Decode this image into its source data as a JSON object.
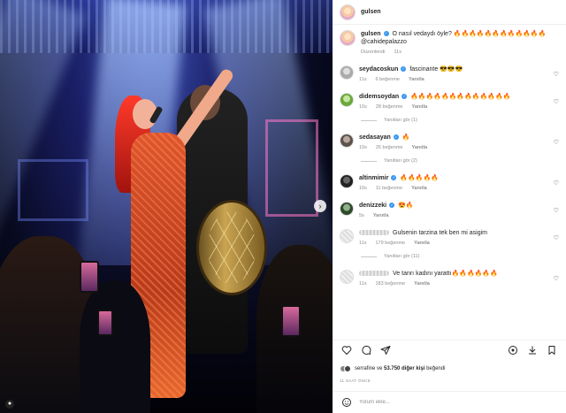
{
  "header": {
    "username": "gulsen"
  },
  "caption": {
    "username": "gulsen",
    "text": "O nasıl vedaydı öyle? 🔥🔥🔥🔥🔥🔥🔥🔥🔥🔥🔥🔥",
    "mention": "@cahidepalazzo",
    "edited": "Düzenlendi",
    "time": "11s"
  },
  "comments": [
    {
      "username": "seydacoskun",
      "text": "fascinante 😎😎😎",
      "time": "11s",
      "likes": "6 beğenme",
      "reply": "Yanıtla",
      "view_replies": ""
    },
    {
      "username": "didemsoydan",
      "text": "🔥🔥🔥🔥🔥🔥🔥🔥🔥🔥🔥🔥🔥",
      "time": "10s",
      "likes": "28 beğenme",
      "reply": "Yanıtla",
      "view_replies": "Yanıtları gör (1)"
    },
    {
      "username": "sedasayan",
      "text": "🔥",
      "time": "10s",
      "likes": "26 beğenme",
      "reply": "Yanıtla",
      "view_replies": "Yanıtları gör (2)"
    },
    {
      "username": "altinmimir",
      "text": "🔥🔥🔥🔥🔥",
      "time": "10s",
      "likes": "11 beğenme",
      "reply": "Yanıtla",
      "view_replies": ""
    },
    {
      "username": "denizzeki",
      "text": "😍🔥",
      "time": "5s",
      "likes": "",
      "reply": "Yanıtla",
      "view_replies": ""
    },
    {
      "username": "",
      "text": "Gulsenin tarzina tek ben mi asigim",
      "time": "11s",
      "likes": "179 beğenme",
      "reply": "Yanıtla",
      "view_replies": "Yanıtları gör (11)"
    },
    {
      "username": "",
      "text": "Ve tanrı kadını yarattı🔥🔥🔥🔥🔥🔥",
      "time": "11s",
      "likes": "183 beğenme",
      "reply": "Yanıtla",
      "view_replies": ""
    }
  ],
  "likes_line": {
    "user": "serrafine",
    "connector": "ve",
    "others": "53.750 diğer kişi",
    "suffix": "beğendi"
  },
  "post_time": "11 SAAT ÖNCE",
  "comment_box": {
    "placeholder": "Yorum ekle..."
  },
  "icons": [
    "heart-icon",
    "comment-icon",
    "share-icon",
    "save-icon",
    "download-icon",
    "translate-icon",
    "emoji-icon",
    "next-slide-icon",
    "user-tag-icon"
  ],
  "colors": {
    "verified": "#3897f0",
    "text": "#262626",
    "muted": "#8e8e8e"
  }
}
